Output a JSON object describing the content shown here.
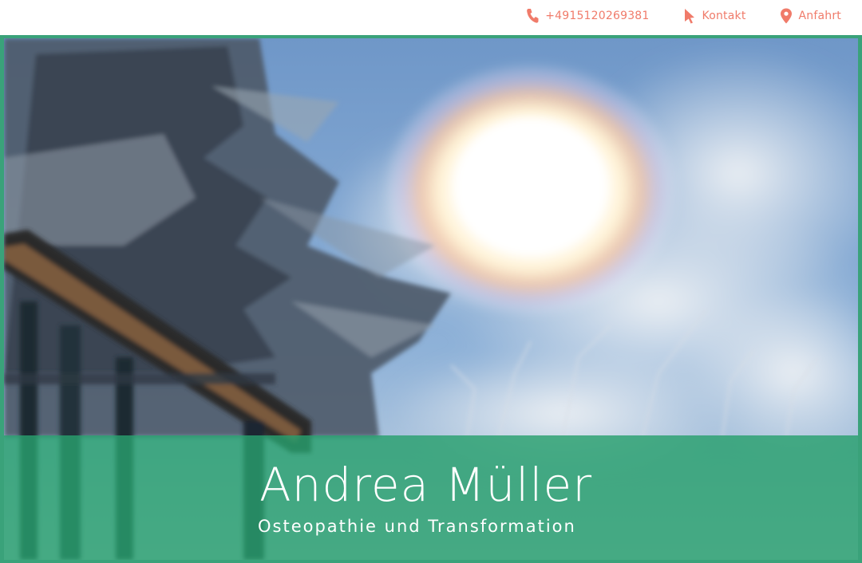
{
  "header": {
    "links": [
      {
        "label": "+4915120269381",
        "icon": "phone-icon"
      },
      {
        "label": "Kontakt",
        "icon": "cursor-icon"
      },
      {
        "label": "Anfahrt",
        "icon": "map-pin-icon"
      }
    ]
  },
  "hero": {
    "title": "Andrea Müller",
    "subtitle": "Osteopathie und Transformation"
  },
  "colors": {
    "accent": "#f07b6a",
    "brand_green": "#3aa27a",
    "banner": "#28a06e",
    "text_on_banner": "#ffffff"
  }
}
